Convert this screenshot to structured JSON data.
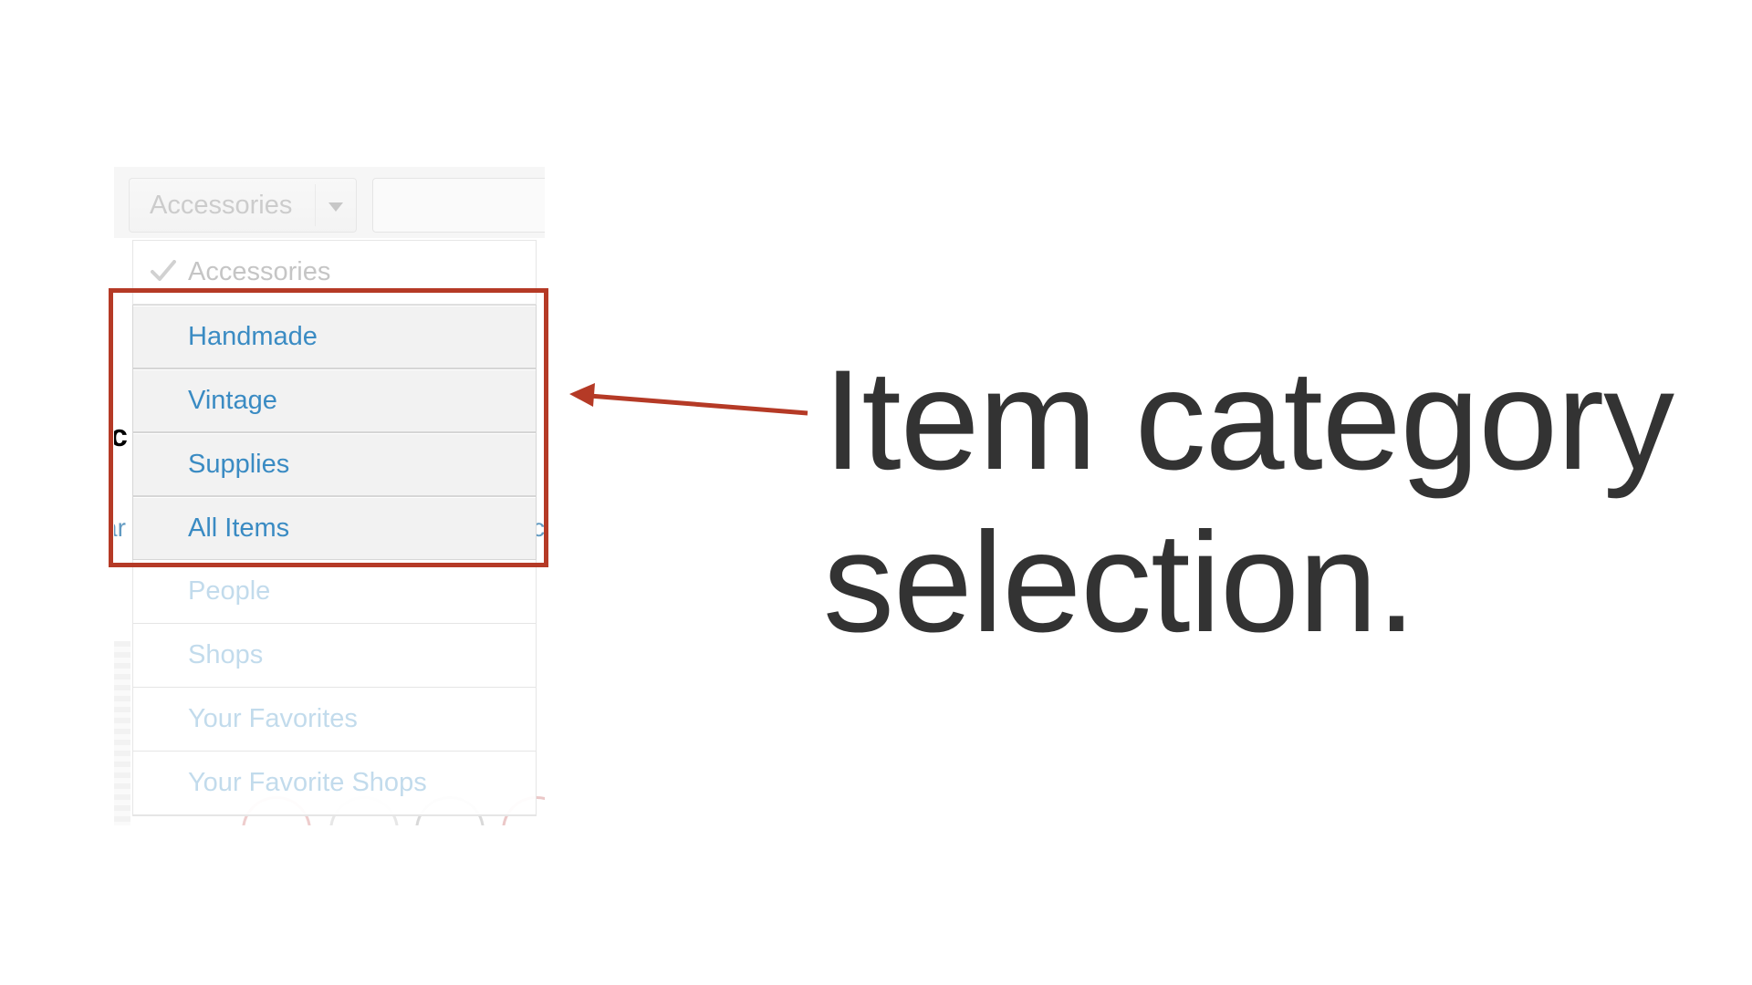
{
  "category_select": {
    "selected_value": "Accessories",
    "caret_icon": "chevron-down-icon"
  },
  "search_field": {
    "value": ""
  },
  "background_fragments": {
    "heading_fragment": "c",
    "left_link_fragment": "ar",
    "right_link_fragment": "c"
  },
  "dropdown": {
    "selected_icon": "check-icon",
    "items": [
      {
        "label": "Accessories",
        "state": "selected"
      },
      {
        "label": "Handmade",
        "state": "highlighted"
      },
      {
        "label": "Vintage",
        "state": "highlighted"
      },
      {
        "label": "Supplies",
        "state": "highlighted"
      },
      {
        "label": "All Items",
        "state": "highlighted"
      },
      {
        "label": "People",
        "state": "dimmed"
      },
      {
        "label": "Shops",
        "state": "dimmed"
      },
      {
        "label": "Your Favorites",
        "state": "dimmed"
      },
      {
        "label": "Your Favorite Shops",
        "state": "dimmed"
      }
    ]
  },
  "annotation": {
    "line1": "Item category",
    "line2": "selection.",
    "box_color": "#b53a26",
    "arrow_color": "#b53a26",
    "text_color": "#333333",
    "link_color": "#4392c5"
  }
}
